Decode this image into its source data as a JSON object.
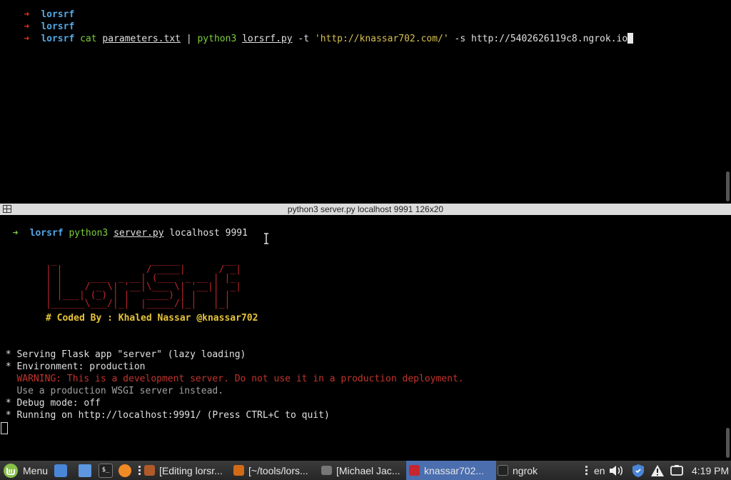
{
  "top_pane": {
    "lines": [
      {
        "arrow": "➜",
        "dir": "lorsrf"
      },
      {
        "arrow": "➜",
        "dir": "lorsrf"
      }
    ],
    "cmd_line": {
      "arrow": "➜",
      "dir": "lorsrf",
      "cmd1": "cat",
      "file1": "parameters.txt",
      "pipe": "|",
      "cmd2": "python3",
      "file2": "lorsrf.py",
      "flag_t": "-t",
      "target": "'http://knassar702.com/'",
      "flag_s": "-s",
      "server": "http://5402626119c8.ngrok.io"
    }
  },
  "divider": {
    "title": "python3 server.py localhost 9991 126x20"
  },
  "bottom_pane": {
    "cmd_line": {
      "arrow": "➜",
      "dir": "lorsrf",
      "cmd": "python3",
      "file": "server.py",
      "args": "localhost 9991"
    },
    "banner": {
      "ascii": " _                 _____        __ \n| |               / ____|      / _|\n| |     ___  _ __| (___  _ __ | |_ \n| |    / _ \\| '__|\\___ \\| '__||  _|\n| |___| (_) | |   ____) | |   | |  \n|______\\___/|_|  |_____/|_|   |_|  ",
      "coded_by": "# Coded By : Khaled Nassar @knassar702"
    },
    "flask": {
      "serving": " * Serving Flask app \"server\" (lazy loading)",
      "env": " * Environment: production",
      "warning": "   WARNING: This is a development server. Do not use it in a production deployment.",
      "wsgi": "   Use a production WSGI server instead.",
      "debug": " * Debug mode: off",
      "running": " * Running on http://localhost:9991/ (Press CTRL+C to quit)"
    }
  },
  "taskbar": {
    "menu_label": "Menu",
    "windows": [
      {
        "label": "[Editing lorsr..."
      },
      {
        "label": "[~/tools/lors..."
      },
      {
        "label": "[Michael Jac..."
      },
      {
        "label": "knassar702..."
      },
      {
        "label": "ngrok"
      }
    ],
    "lang": "en",
    "clock": "4:19 PM"
  },
  "colors": {
    "accent": "#4b6eaf",
    "prompt_dir": "#53a8e6",
    "arrow_red": "#e0361e",
    "arrow_green": "#7ccf3d",
    "warning": "#c2342c",
    "coded": "#e7c43a"
  }
}
